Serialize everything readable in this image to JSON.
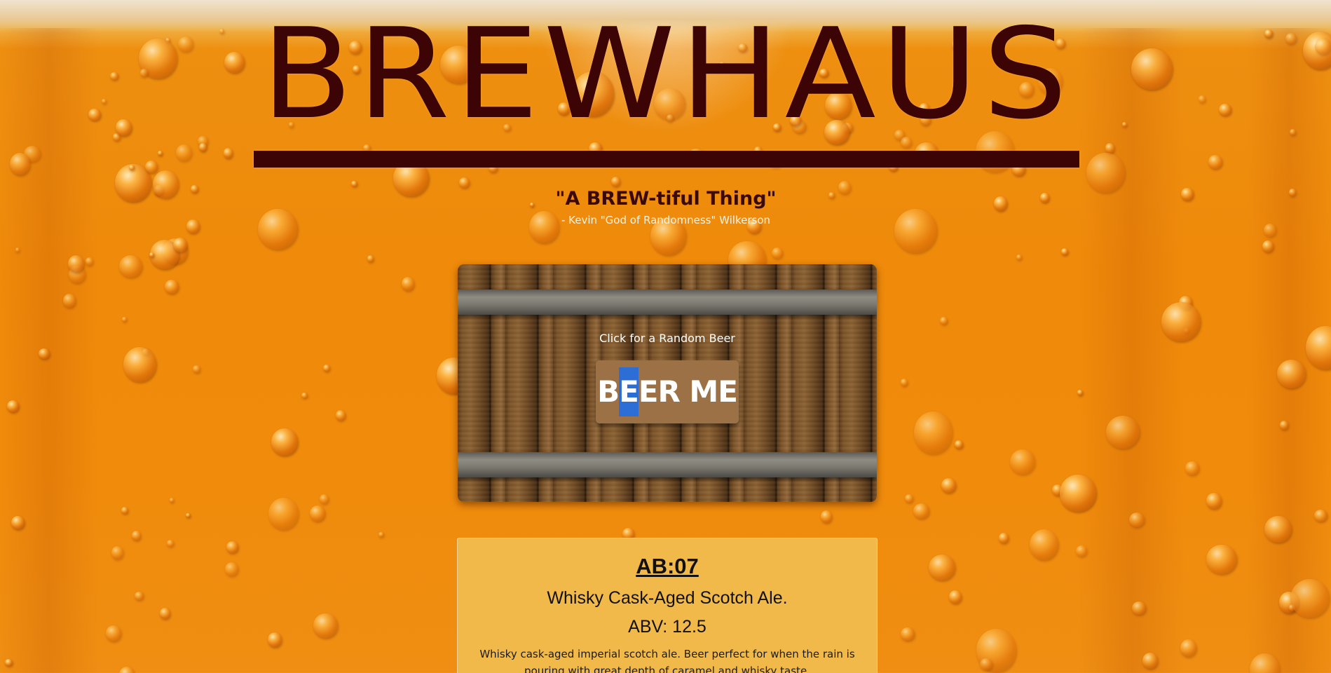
{
  "brand": {
    "title": "BREWHAUS"
  },
  "tagline": {
    "quote": "\"A BREW-tiful Thing\"",
    "attribution": "- Kevin \"God of Randomness\" Wilkerson"
  },
  "randomizer": {
    "label": "Click for a Random Beer",
    "button_label": "BEER ME",
    "button_label_parts": [
      "B",
      "E",
      "ER ME"
    ],
    "button_color": "#9c7145"
  },
  "beer": {
    "name": "AB:07",
    "tagline": "Whisky Cask-Aged Scotch Ale.",
    "abv": "ABV: 12.5",
    "description": "Whisky cask-aged imperial scotch ale. Beer perfect for when the rain is pouring with great depth of caramel and whisky taste."
  },
  "colors": {
    "title": "#3d0405",
    "card_background": "#f1b94a",
    "beer_orange": "#ef8a0a",
    "selection": "#2c6ed6"
  }
}
